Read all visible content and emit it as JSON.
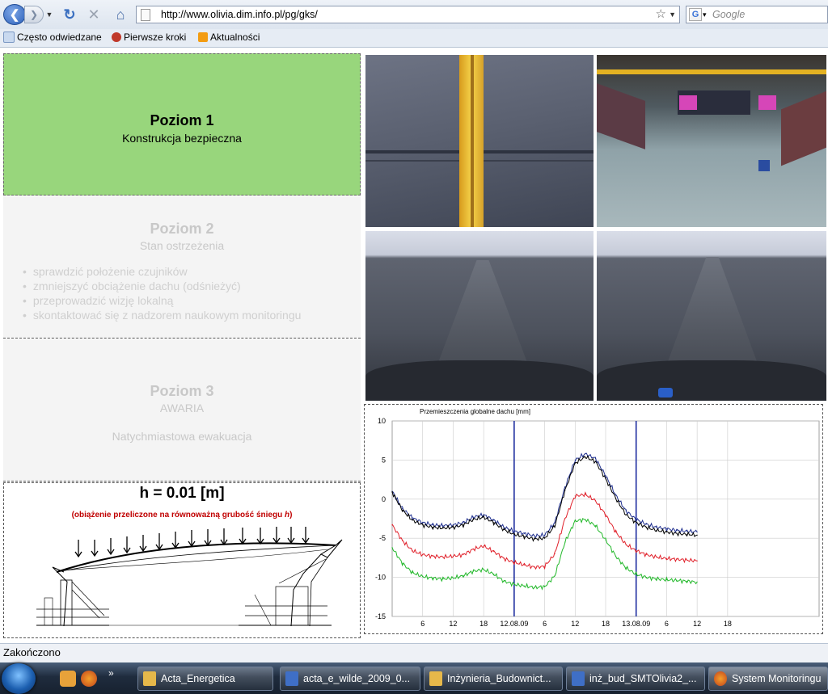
{
  "browser": {
    "url": "http://www.olivia.dim.info.pl/pg/gks/",
    "search_placeholder": "Google",
    "bookmarks": [
      {
        "label": "Często odwiedzane",
        "icon": "bookmark-page-icon"
      },
      {
        "label": "Pierwsze kroki",
        "icon": "firefox-icon"
      },
      {
        "label": "Aktualności",
        "icon": "rss-icon"
      }
    ],
    "status_text": "Zakończono"
  },
  "levels": [
    {
      "title": "Poziom 1",
      "subtitle": "Konstrukcja bezpieczna",
      "active": true,
      "color": "#98d67c"
    },
    {
      "title": "Poziom 2",
      "subtitle": "Stan ostrzeżenia",
      "active": false,
      "recommendations": [
        "sprawdzić położenie czujników",
        "zmniejszyć obciążenie dachu (odśnieżyć)",
        "przeprowadzić wizję lokalną",
        "skontaktować się z nadzorem naukowym monitoringu"
      ]
    },
    {
      "title": "Poziom 3",
      "subtitle": "AWARIA",
      "active": false,
      "action": "Natychmiastowa ewakuacja"
    }
  ],
  "snow": {
    "value": "h = 0.01 [m]",
    "note_prefix": "(obiążenie przeliczone na równoważną grubość śniegu ",
    "note_var": "h",
    "note_suffix": ")"
  },
  "chart_data": {
    "type": "line",
    "title": "Przemieszczenia globalne dachu [mm]",
    "ylim": [
      -15,
      10
    ],
    "yticks": [
      10,
      5,
      0,
      -5,
      -10,
      -15
    ],
    "x_tick_labels": [
      "6",
      "12",
      "18",
      "12.08.09",
      "6",
      "12",
      "18",
      "13.08.09",
      "6",
      "12",
      "18"
    ],
    "x_unit": "hours since 11.08.09 00:00 (tick labels show hour of day / date)",
    "xlim": [
      0,
      84
    ],
    "xticks": [
      6,
      12,
      18,
      24,
      30,
      36,
      42,
      48,
      54,
      60,
      66
    ],
    "day_markers": [
      24,
      48
    ],
    "grid": true,
    "series": [
      {
        "color": "#1f2f8f",
        "x": [
          0,
          2,
          4,
          6,
          8,
          10,
          12,
          14,
          16,
          18,
          20,
          22,
          24,
          26,
          28,
          30,
          32,
          34,
          36,
          38,
          40,
          42,
          44,
          46,
          48,
          50,
          52,
          54,
          56,
          58,
          60
        ],
        "values": [
          1.0,
          -1.2,
          -2.4,
          -3.0,
          -3.3,
          -3.4,
          -3.3,
          -3.0,
          -2.3,
          -2.0,
          -2.7,
          -3.6,
          -4.1,
          -4.4,
          -4.7,
          -4.6,
          -3.0,
          1.5,
          5.0,
          5.8,
          5.2,
          3.0,
          0.5,
          -1.5,
          -2.6,
          -3.2,
          -3.6,
          -3.8,
          -4.0,
          -4.1,
          -4.2
        ]
      },
      {
        "color": "#000000",
        "x": [
          0,
          2,
          4,
          6,
          8,
          10,
          12,
          14,
          16,
          18,
          20,
          22,
          24,
          26,
          28,
          30,
          32,
          34,
          36,
          38,
          40,
          42,
          44,
          46,
          48,
          50,
          52,
          54,
          56,
          58,
          60
        ],
        "values": [
          0.9,
          -1.4,
          -2.7,
          -3.3,
          -3.6,
          -3.7,
          -3.6,
          -3.3,
          -2.6,
          -2.3,
          -3.0,
          -3.9,
          -4.5,
          -4.8,
          -5.1,
          -5.0,
          -3.4,
          1.1,
          4.6,
          5.4,
          4.8,
          2.6,
          0.1,
          -2.0,
          -3.0,
          -3.6,
          -4.0,
          -4.2,
          -4.4,
          -4.5,
          -4.6
        ]
      },
      {
        "color": "#e0202a",
        "x": [
          0,
          2,
          4,
          6,
          8,
          10,
          12,
          14,
          16,
          18,
          20,
          22,
          24,
          26,
          28,
          30,
          32,
          34,
          36,
          38,
          40,
          42,
          44,
          46,
          48,
          50,
          52,
          54,
          56,
          58,
          60
        ],
        "values": [
          -3.3,
          -5.3,
          -6.6,
          -7.1,
          -7.3,
          -7.4,
          -7.3,
          -7.1,
          -6.4,
          -6.0,
          -6.7,
          -7.6,
          -8.1,
          -8.4,
          -8.7,
          -8.6,
          -7.0,
          -2.5,
          0.4,
          0.6,
          -0.2,
          -2.0,
          -4.2,
          -5.8,
          -6.6,
          -7.1,
          -7.4,
          -7.6,
          -7.7,
          -7.8,
          -7.9
        ]
      },
      {
        "color": "#22b82a",
        "x": [
          0,
          2,
          4,
          6,
          8,
          10,
          12,
          14,
          16,
          18,
          20,
          22,
          24,
          26,
          28,
          30,
          32,
          34,
          36,
          38,
          40,
          42,
          44,
          46,
          48,
          50,
          52,
          54,
          56,
          58,
          60
        ],
        "values": [
          -6.2,
          -8.2,
          -9.4,
          -9.9,
          -10.1,
          -10.2,
          -10.1,
          -9.8,
          -9.2,
          -9.0,
          -9.6,
          -10.5,
          -10.9,
          -11.1,
          -11.3,
          -11.2,
          -9.8,
          -5.5,
          -2.8,
          -2.6,
          -3.4,
          -5.2,
          -7.3,
          -8.8,
          -9.6,
          -10.0,
          -10.2,
          -10.3,
          -10.4,
          -10.5,
          -10.6
        ]
      }
    ]
  },
  "taskbar": {
    "items": [
      {
        "label": "Acta_Energetica",
        "icon": "folder-icon",
        "color": "#e6b84a"
      },
      {
        "label": "acta_e_wilde_2009_0...",
        "icon": "word-doc-icon",
        "color": "#3f6fc6"
      },
      {
        "label": "Inżynieria_Budownict...",
        "icon": "folder-icon",
        "color": "#e6b84a"
      },
      {
        "label": "inż_bud_SMTOlivia2_...",
        "icon": "word-doc-icon",
        "color": "#3f6fc6"
      },
      {
        "label": "System Monitoringu",
        "icon": "firefox-icon",
        "color": "#e8731c"
      }
    ]
  }
}
